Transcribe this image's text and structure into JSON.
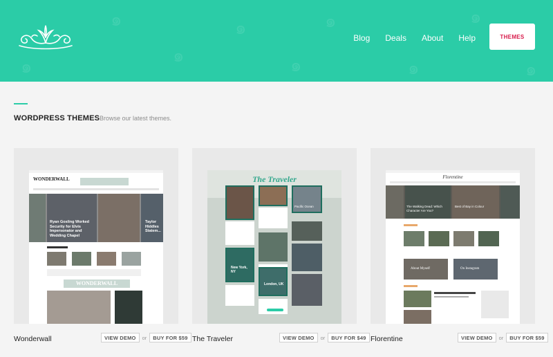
{
  "nav": {
    "items": [
      "Blog",
      "Deals",
      "About",
      "Help"
    ],
    "themes_button": "THEMES"
  },
  "section": {
    "title": "WORDPRESS THEMES",
    "subtitle": "Browse our latest themes."
  },
  "themes": [
    {
      "name": "Wonderwall",
      "view_demo": "VIEW DEMO",
      "or": "or",
      "buy": "BUY FOR $59",
      "preview_logo": "WONDERWALL",
      "preview_banner": "WONDERWALL",
      "preview_headline": "Ryan Gosling Worked Security for Elvis Impersonator and Wedding Chapel",
      "preview_side": "Taylor Hiddles Statem..."
    },
    {
      "name": "The Traveler",
      "view_demo": "VIEW DEMO",
      "or": "or",
      "buy": "BUY FOR $49",
      "preview_logo": "The Traveler",
      "preview_tile_1": "Pacific Ocean",
      "preview_tile_2": "New York, NY",
      "preview_tile_3": "London, UK"
    },
    {
      "name": "Florentine",
      "view_demo": "VIEW DEMO",
      "or": "or",
      "buy": "BUY FOR $59",
      "preview_logo": "Florentine",
      "preview_head_1": "The Walking Dead: Which Character Are You?",
      "preview_head_2": "Best of Bay in Colour",
      "preview_tag_1": "About Myself",
      "preview_tag_2": "On Instagram"
    }
  ],
  "colors": {
    "header": "#2bcca7",
    "accent": "#d81b4b"
  }
}
